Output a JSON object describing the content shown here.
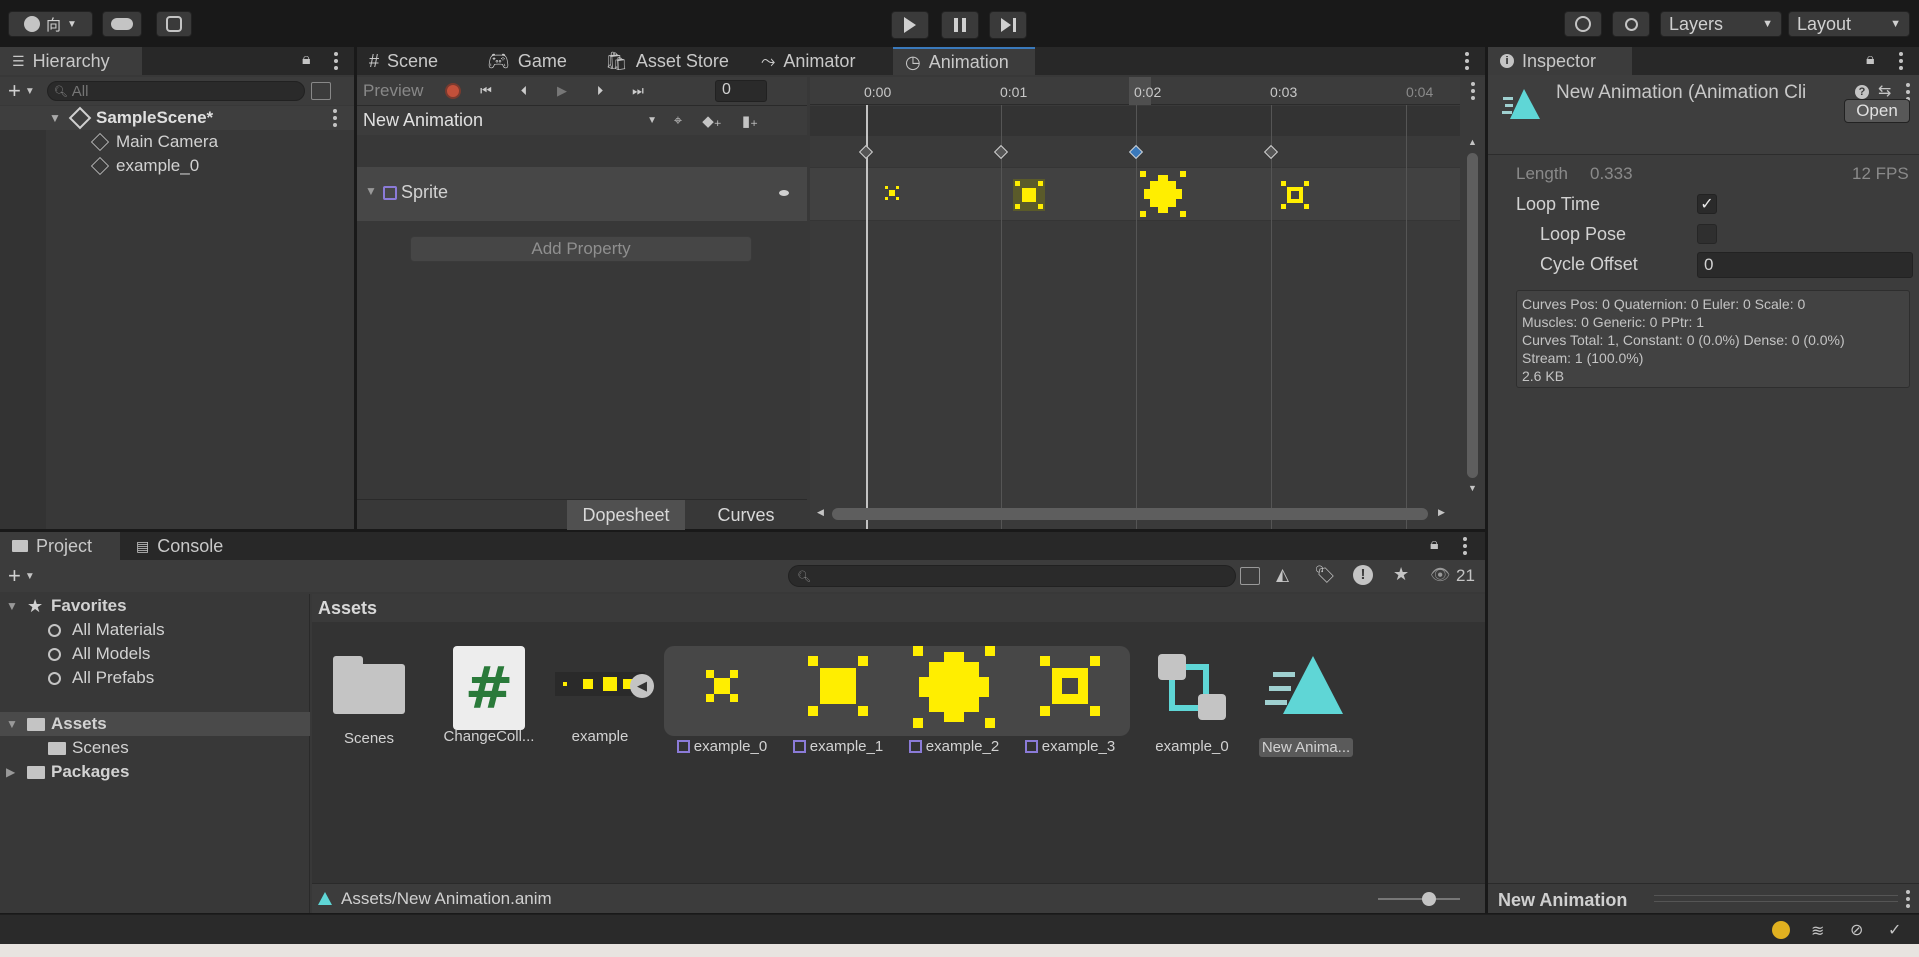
{
  "toolbar": {
    "account_label": "向",
    "layers_label": "Layers",
    "layout_label": "Layout"
  },
  "hierarchy": {
    "tab_label": "Hierarchy",
    "search_placeholder": "All",
    "scene_name": "SampleScene*",
    "items": [
      {
        "label": "Main Camera"
      },
      {
        "label": "example_0"
      }
    ]
  },
  "center_tabs": [
    {
      "label": "Scene"
    },
    {
      "label": "Game"
    },
    {
      "label": "Asset Store"
    },
    {
      "label": "Animator"
    },
    {
      "label": "Animation"
    }
  ],
  "animation": {
    "preview_label": "Preview",
    "frame_value": "0",
    "clip_name": "New Animation",
    "property_name": "Sprite",
    "add_property_label": "Add Property",
    "dopesheet_label": "Dopesheet",
    "curves_label": "Curves",
    "time_ticks": [
      "0:00",
      "0:01",
      "0:02",
      "0:03",
      "0:04"
    ],
    "selected_keyframe_index": 2
  },
  "inspector": {
    "tab_label": "Inspector",
    "title": "New Animation (Animation Cli",
    "open_label": "Open",
    "length_label": "Length",
    "length_value": "0.333",
    "fps_value": "12 FPS",
    "loop_time_label": "Loop Time",
    "loop_time_checked": true,
    "loop_pose_label": "Loop Pose",
    "loop_pose_checked": false,
    "cycle_offset_label": "Cycle Offset",
    "cycle_offset_value": "0",
    "stats": [
      "Curves Pos: 0 Quaternion: 0 Euler: 0 Scale: 0",
      "Muscles: 0 Generic: 0 PPtr: 1",
      "Curves Total: 1, Constant: 0 (0.0%) Dense: 0 (0.0%)",
      "Stream: 1 (100.0%)",
      "2.6 KB"
    ],
    "preview_title": "New Animation"
  },
  "project": {
    "tabs": [
      {
        "label": "Project"
      },
      {
        "label": "Console"
      }
    ],
    "hidden_count": "21",
    "favorites_label": "Favorites",
    "favorites": [
      {
        "label": "All Materials"
      },
      {
        "label": "All Models"
      },
      {
        "label": "All Prefabs"
      }
    ],
    "assets_label": "Assets",
    "scenes_label": "Scenes",
    "packages_label": "Packages",
    "breadcrumb": "Assets",
    "items": [
      {
        "label": "Scenes"
      },
      {
        "label": "ChangeColl..."
      },
      {
        "label": "example"
      },
      {
        "label": "example_0"
      },
      {
        "label": "example_1"
      },
      {
        "label": "example_2"
      },
      {
        "label": "example_3"
      },
      {
        "label": "example_0"
      },
      {
        "label": "New Anima..."
      }
    ],
    "footer_path": "Assets/New Animation.anim"
  },
  "colors": {
    "accent_blue": "#3a79bb",
    "sprite_yellow": "#ffee00",
    "anim_icon": "#5fd6d6"
  }
}
